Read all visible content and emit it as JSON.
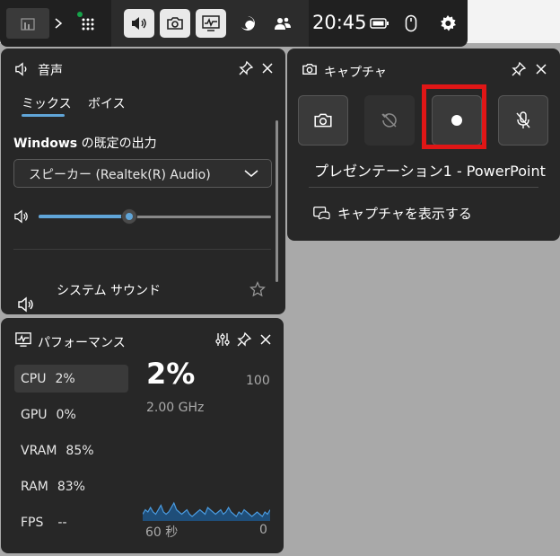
{
  "topbar": {
    "time": "20:45"
  },
  "audio": {
    "title": "音声",
    "tabs": [
      {
        "label": "ミックス",
        "selected": true
      },
      {
        "label": "ボイス",
        "selected": false
      }
    ],
    "output_label_bold": "Windows",
    "output_label_rest": " の既定の出力",
    "device": "スピーカー (Realtek(R) Audio)",
    "volume_fraction": 0.39,
    "app_name": "システム サウンド"
  },
  "capture": {
    "title": "キャプチャ",
    "app_title": "プレゼンテーション1 - PowerPoint",
    "show_captures": "キャプチャを表示する",
    "highlight_color": "#e01616"
  },
  "performance": {
    "title": "パフォーマンス",
    "items": [
      {
        "label": "CPU",
        "value": "2%",
        "selected": true
      },
      {
        "label": "GPU",
        "value": "0%",
        "selected": false
      },
      {
        "label": "VRAM",
        "value": "85%",
        "selected": false
      },
      {
        "label": "RAM",
        "value": "83%",
        "selected": false
      },
      {
        "label": "FPS",
        "value": "--",
        "selected": false
      }
    ],
    "big_value": "2%",
    "sub_value": "2.00 GHz",
    "max_label": "100",
    "axis_left": "60 秒",
    "axis_right": "0",
    "series": [
      3,
      5,
      4,
      6,
      4,
      3,
      5,
      7,
      4,
      3,
      4,
      6,
      8,
      5,
      4,
      3,
      4,
      5,
      3,
      2,
      3,
      4,
      5,
      4,
      3,
      6,
      5,
      4,
      3,
      4,
      5,
      3,
      4,
      6,
      4,
      3,
      2,
      4,
      3,
      5,
      4,
      3,
      2,
      3,
      4,
      3,
      2,
      4,
      3,
      5
    ]
  },
  "colors": {
    "accent": "#60a5d8",
    "panel": "#272727",
    "record_red": "#e01616"
  }
}
